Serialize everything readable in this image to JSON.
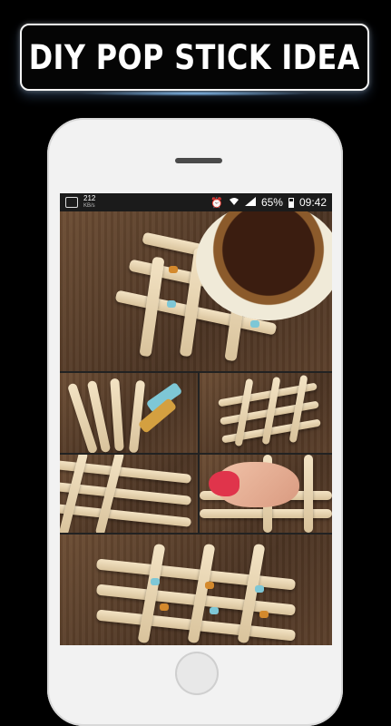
{
  "banner": {
    "title": "DIY POP STICK IDEA"
  },
  "status_bar": {
    "speed_value": "212",
    "speed_unit": "KB/s",
    "alarm_icon": "alarm-icon",
    "wifi_icon": "wifi-icon",
    "signal_icon": "signal-icon",
    "battery": "65%",
    "time": "09:42"
  },
  "colors": {
    "background": "#000000",
    "phone_body": "#f2f2f2",
    "status_bar": "#1b1b1b",
    "wood": "#5b3f2a",
    "stick": "#e8d4ae",
    "thread_blue": "#7ec7d6",
    "thread_orange": "#d4892c"
  },
  "gallery": {
    "photos": [
      "coaster-with-mug",
      "sticks-and-thread",
      "finished-grid",
      "gluing-grid",
      "grid-closeup",
      "tied-grid"
    ]
  }
}
